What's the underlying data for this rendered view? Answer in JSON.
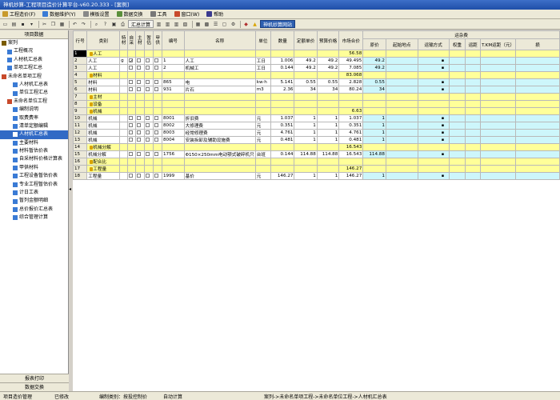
{
  "title": "神机妙算-工程项目造价计算平台-v60.20.333 - [案例]",
  "menu": [
    {
      "label": "工程造价(F)",
      "color": "#c89a2b"
    },
    {
      "label": "数据维护(Y)",
      "color": "#3a7bd5"
    },
    {
      "label": "模板设置",
      "color": "#888888"
    },
    {
      "label": "数据交换",
      "color": "#5a8f3a"
    },
    {
      "label": "工具",
      "color": "#777777"
    },
    {
      "label": "窗口(W)",
      "color": "#c84a2b"
    },
    {
      "label": "帮助",
      "color": "#3a3a8f"
    }
  ],
  "toolbar": {
    "sum_label": "汇总计算",
    "net_label": "神机妙算网站"
  },
  "left": {
    "header": "项目数据",
    "tree": [
      {
        "label": "案列",
        "indent": 0,
        "color": "#7a5c00"
      },
      {
        "label": "工程概况",
        "indent": 1,
        "color": "#3a7bd5"
      },
      {
        "label": "人材机汇总表",
        "indent": 1,
        "color": "#3a7bd5"
      },
      {
        "label": "单项工程汇总",
        "indent": 1,
        "color": "#3a7bd5"
      },
      {
        "label": "未命名单项工程",
        "indent": 0,
        "color": "#c84a2b"
      },
      {
        "label": "人材机汇总表",
        "indent": 2,
        "color": "#3a7bd5"
      },
      {
        "label": "单位工程汇总",
        "indent": 2,
        "color": "#3a7bd5"
      },
      {
        "label": "未命名单位工程",
        "indent": 1,
        "color": "#c84a2b"
      },
      {
        "label": "编制说明",
        "indent": 2,
        "color": "#3a7bd5"
      },
      {
        "label": "取费费率",
        "indent": 2,
        "color": "#3a7bd5"
      },
      {
        "label": "清单定额编辑",
        "indent": 2,
        "color": "#3a7bd5"
      },
      {
        "label": "人材机汇总表",
        "indent": 2,
        "color": "#ffffff",
        "selected": true
      },
      {
        "label": "主要材料",
        "indent": 2,
        "color": "#3a7bd5"
      },
      {
        "label": "材料暂估价表",
        "indent": 2,
        "color": "#3a7bd5"
      },
      {
        "label": "自采材料价格计算表",
        "indent": 2,
        "color": "#3a7bd5"
      },
      {
        "label": "甲供材料",
        "indent": 2,
        "color": "#3a7bd5"
      },
      {
        "label": "工程设备暂估价表",
        "indent": 2,
        "color": "#3a7bd5"
      },
      {
        "label": "专业工程暂估价表",
        "indent": 2,
        "color": "#3a7bd5"
      },
      {
        "label": "计日工表",
        "indent": 2,
        "color": "#3a7bd5"
      },
      {
        "label": "暂列金额明细",
        "indent": 2,
        "color": "#3a7bd5"
      },
      {
        "label": "总价报价汇总表",
        "indent": 2,
        "color": "#3a7bd5"
      },
      {
        "label": "综合管理计算",
        "indent": 2,
        "color": "#3a7bd5"
      }
    ],
    "btn_print": "报表打印",
    "btn_exchange": "数据交换"
  },
  "grid": {
    "headers": {
      "rowno": "行号",
      "category": "类别",
      "special": "特材",
      "self": "自采",
      "main": "主材",
      "temp": "暂估",
      "supply": "甲供",
      "code": "编号",
      "name": "名称",
      "unit": "单位",
      "qty": "数量",
      "quota_price": "定额单价",
      "budget_price": "预算价格",
      "market_price": "市场合价",
      "freight_group": "运杂费",
      "orig_price": "原价",
      "origin": "起始地点",
      "transport": "运输方式",
      "weight": "权重",
      "distance": "运距",
      "tkm": "T.KM运距（元）",
      "more": "损"
    },
    "rows": [
      {
        "no": "1",
        "cat": "人工",
        "code": "",
        "name": "",
        "unit": "",
        "qty": "",
        "quota": "",
        "budget": "",
        "market": "56.58",
        "orig": "",
        "yellow": true,
        "lock": true,
        "selected": true,
        "dot": false
      },
      {
        "no": "2",
        "cat": "人工",
        "special": "g",
        "chk3": true,
        "code": "1",
        "name": "人工",
        "unit": "工日",
        "qty": "1.006",
        "quota": "49.2",
        "budget": "49.2",
        "market": "49.495",
        "orig": "49.2",
        "yellow": false,
        "dot": true
      },
      {
        "no": "3",
        "cat": "人工",
        "code": "2",
        "name": "机械工",
        "unit": "工日",
        "qty": "0.144",
        "quota": "49.2",
        "budget": "49.2",
        "market": "7.085",
        "orig": "49.2",
        "yellow": false,
        "dot": true
      },
      {
        "no": "4",
        "cat": "材料",
        "code": "",
        "name": "",
        "unit": "",
        "qty": "",
        "quota": "",
        "budget": "",
        "market": "83.068",
        "orig": "",
        "yellow": true,
        "lock": true,
        "dot": false
      },
      {
        "no": "5",
        "cat": "材料",
        "code": "865",
        "name": "电",
        "unit": "kw·h",
        "qty": "5.141",
        "quota": "0.55",
        "budget": "0.55",
        "market": "2.828",
        "orig": "0.55",
        "yellow": false,
        "dot": true
      },
      {
        "no": "6",
        "cat": "材料",
        "code": "931",
        "name": "片石",
        "unit": "m3",
        "qty": "2.36",
        "quota": "34",
        "budget": "34",
        "market": "80.24",
        "orig": "34",
        "yellow": false,
        "dot": true
      },
      {
        "no": "7",
        "cat": "主材",
        "code": "",
        "name": "",
        "unit": "",
        "qty": "",
        "quota": "",
        "budget": "",
        "market": "",
        "orig": "",
        "yellow": true,
        "lock": true,
        "dot": false
      },
      {
        "no": "8",
        "cat": "设备",
        "code": "",
        "name": "",
        "unit": "",
        "qty": "",
        "quota": "",
        "budget": "",
        "market": "",
        "orig": "",
        "yellow": true,
        "lock": true,
        "dot": false
      },
      {
        "no": "9",
        "cat": "机械",
        "code": "",
        "name": "",
        "unit": "",
        "qty": "",
        "quota": "",
        "budget": "",
        "market": "6.63",
        "orig": "",
        "yellow": true,
        "lock": true,
        "dot": false
      },
      {
        "no": "10",
        "cat": "机械",
        "code": "8001",
        "name": "折旧费",
        "unit": "元",
        "qty": "1.037",
        "quota": "1",
        "budget": "1",
        "market": "1.037",
        "orig": "1",
        "yellow": false,
        "dot": true
      },
      {
        "no": "11",
        "cat": "机械",
        "code": "8002",
        "name": "大修理费",
        "unit": "元",
        "qty": "0.351",
        "quota": "1",
        "budget": "1",
        "market": "0.351",
        "orig": "1",
        "yellow": false,
        "dot": true
      },
      {
        "no": "12",
        "cat": "机械",
        "code": "8003",
        "name": "经常修理费",
        "unit": "元",
        "qty": "4.761",
        "quota": "1",
        "budget": "1",
        "market": "4.761",
        "orig": "1",
        "yellow": false,
        "dot": true
      },
      {
        "no": "13",
        "cat": "机械",
        "code": "8004",
        "name": "安装拆卸及辅助设施费",
        "unit": "元",
        "qty": "0.481",
        "quota": "1",
        "budget": "1",
        "market": "0.481",
        "orig": "1",
        "yellow": false,
        "dot": true
      },
      {
        "no": "14",
        "cat": "机械分解",
        "code": "",
        "name": "",
        "unit": "",
        "qty": "",
        "quota": "",
        "budget": "",
        "market": "16.543",
        "orig": "",
        "yellow": true,
        "lock": true,
        "dot": false
      },
      {
        "no": "15",
        "cat": "机械分解",
        "code": "1756",
        "name": "Φ150×250mm电动颚式破碎机只",
        "unit": "台班",
        "qty": "0.144",
        "quota": "114.88",
        "budget": "114.88",
        "market": "16.543",
        "orig": "114.88",
        "yellow": false,
        "dot": true
      },
      {
        "no": "16",
        "cat": "配合比",
        "code": "",
        "name": "",
        "unit": "",
        "qty": "",
        "quota": "",
        "budget": "",
        "market": "",
        "orig": "",
        "yellow": true,
        "lock": true,
        "dot": false
      },
      {
        "no": "17",
        "cat": "工程量",
        "code": "",
        "name": "",
        "unit": "",
        "qty": "",
        "quota": "",
        "budget": "",
        "market": "146.27",
        "orig": "",
        "yellow": true,
        "lock": true,
        "dot": false
      },
      {
        "no": "18",
        "cat": "工程量",
        "code": "1999",
        "name": "基价",
        "unit": "元",
        "qty": "146.27",
        "quota": "1",
        "budget": "1",
        "market": "146.27",
        "orig": "1",
        "yellow": false,
        "dot": true
      }
    ]
  },
  "status": {
    "s1": "项目造价管理",
    "s2": "已修改",
    "s3": "编制类别：按投控制价",
    "s4": "自动计算",
    "s5": "案列->未命名单项工程->未命名单位工程->人材机汇总表"
  }
}
